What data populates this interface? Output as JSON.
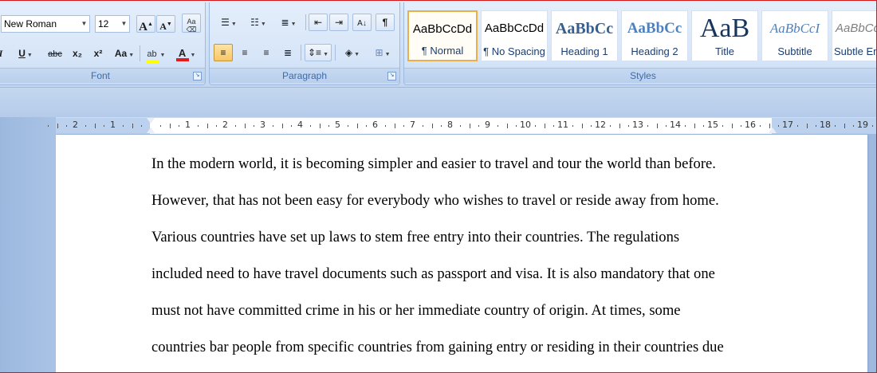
{
  "ribbon": {
    "font": {
      "group_label": "Font",
      "font_name": "New Roman",
      "font_size": "12",
      "grow_font": "A",
      "shrink_font": "A",
      "underline": "U",
      "strikethrough": "abc",
      "subscript": "x₂",
      "superscript": "x²",
      "change_case": "Aa",
      "highlight_color": "#ffff00",
      "font_color": "#e31b1b"
    },
    "paragraph": {
      "group_label": "Paragraph",
      "show_marks": "¶"
    },
    "styles": {
      "group_label": "Styles",
      "items": [
        {
          "preview": "AaBbCcDd",
          "label": "¶ Normal",
          "selected": true
        },
        {
          "preview": "AaBbCcDd",
          "label": "¶ No Spacing",
          "selected": false
        },
        {
          "preview": "AaBbCc",
          "label": "Heading 1",
          "selected": false
        },
        {
          "preview": "AaBbCc",
          "label": "Heading 2",
          "selected": false
        },
        {
          "preview": "AaB",
          "label": "Title",
          "selected": false
        },
        {
          "preview": "AaBbCcI",
          "label": "Subtitle",
          "selected": false
        },
        {
          "preview": "AaBbCcI",
          "label": "Subtle Em",
          "selected": false
        }
      ]
    }
  },
  "ruler": {
    "left_numbers": [
      "2",
      "1"
    ],
    "right_numbers": [
      "1",
      "2",
      "3",
      "4",
      "5",
      "6",
      "7",
      "8",
      "9",
      "10",
      "11",
      "12",
      "13",
      "14",
      "15",
      "16",
      "17",
      "18",
      "19"
    ]
  },
  "document": {
    "lines": [
      "In the modern world, it is becoming simpler and easier to travel and tour the world than before.",
      "However, that has not been easy for everybody who wishes to travel or reside away from home.",
      "Various countries have set up laws to stem free entry into their countries. The regulations",
      "included need to have travel documents such as passport and visa. It is also mandatory that one",
      "must not have committed crime in his or her immediate country of origin. At times, some",
      "countries bar people from specific countries from gaining entry or residing in their countries due"
    ]
  }
}
